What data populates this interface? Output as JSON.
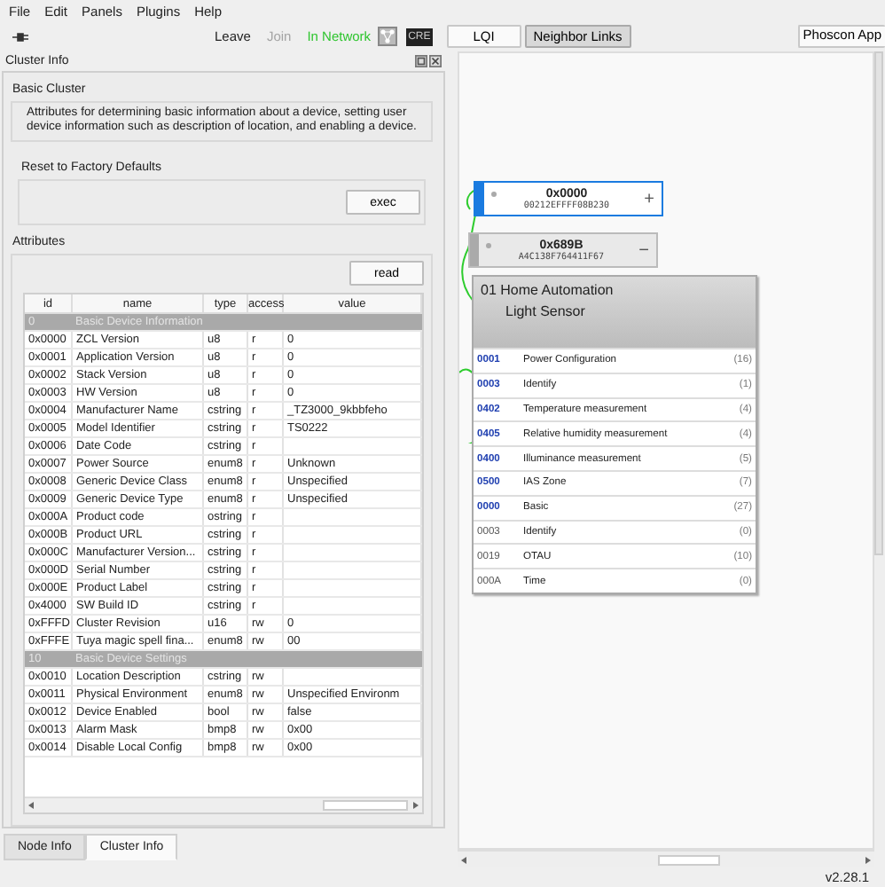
{
  "menu": [
    "File",
    "Edit",
    "Panels",
    "Plugins",
    "Help"
  ],
  "toolbar": {
    "actions": [
      {
        "label": "Leave",
        "disabled": false
      },
      {
        "label": "Join",
        "disabled": true
      }
    ],
    "network_status": "In Network",
    "badge": "CRE",
    "view_buttons": [
      {
        "label": "LQI",
        "pressed": false
      },
      {
        "label": "Neighbor Links",
        "pressed": true
      }
    ],
    "app_button": "Phoscon App"
  },
  "cluster_info": {
    "title": "Cluster Info",
    "cluster_name": "Basic Cluster",
    "description": "Attributes for determining basic information about a device, setting user device information such as description of location, and enabling a device.",
    "command": {
      "label": "Reset to Factory Defaults",
      "button": "exec"
    },
    "attributes_label": "Attributes",
    "read_button": "read",
    "columns": [
      "id",
      "name",
      "type",
      "access",
      "value"
    ],
    "rows": [
      {
        "kind": "group",
        "id": "0",
        "name": "Basic Device Information"
      },
      {
        "kind": "attribute",
        "id": "0x0000",
        "name": "ZCL Version",
        "type": "u8",
        "access": "r",
        "value": "0"
      },
      {
        "kind": "attribute",
        "id": "0x0001",
        "name": "Application Version",
        "type": "u8",
        "access": "r",
        "value": "0"
      },
      {
        "kind": "attribute",
        "id": "0x0002",
        "name": "Stack Version",
        "type": "u8",
        "access": "r",
        "value": "0"
      },
      {
        "kind": "attribute",
        "id": "0x0003",
        "name": "HW Version",
        "type": "u8",
        "access": "r",
        "value": "0"
      },
      {
        "kind": "attribute",
        "id": "0x0004",
        "name": "Manufacturer Name",
        "type": "cstring",
        "access": "r",
        "value": "_TZ3000_9kbbfeho"
      },
      {
        "kind": "attribute",
        "id": "0x0005",
        "name": "Model Identifier",
        "type": "cstring",
        "access": "r",
        "value": "TS0222"
      },
      {
        "kind": "attribute",
        "id": "0x0006",
        "name": "Date Code",
        "type": "cstring",
        "access": "r"
      },
      {
        "kind": "attribute",
        "id": "0x0007",
        "name": "Power Source",
        "type": "enum8",
        "access": "r",
        "value": "Unknown"
      },
      {
        "kind": "attribute",
        "id": "0x0008",
        "name": "Generic Device Class",
        "type": "enum8",
        "access": "r",
        "value": "Unspecified"
      },
      {
        "kind": "attribute",
        "id": "0x0009",
        "name": "Generic Device Type",
        "type": "enum8",
        "access": "r",
        "value": "Unspecified"
      },
      {
        "kind": "attribute",
        "id": "0x000A",
        "name": "Product code",
        "type": "ostring",
        "access": "r"
      },
      {
        "kind": "attribute",
        "id": "0x000B",
        "name": "Product URL",
        "type": "cstring",
        "access": "r"
      },
      {
        "kind": "attribute",
        "id": "0x000C",
        "name": "Manufacturer Version...",
        "type": "cstring",
        "access": "r"
      },
      {
        "kind": "attribute",
        "id": "0x000D",
        "name": "Serial Number",
        "type": "cstring",
        "access": "r"
      },
      {
        "kind": "attribute",
        "id": "0x000E",
        "name": "Product Label",
        "type": "cstring",
        "access": "r"
      },
      {
        "kind": "attribute",
        "id": "0x4000",
        "name": "SW Build ID",
        "type": "cstring",
        "access": "r"
      },
      {
        "kind": "attribute",
        "id": "0xFFFD",
        "name": "Cluster Revision",
        "type": "u16",
        "access": "rw",
        "value": "0"
      },
      {
        "kind": "attribute",
        "id": "0xFFFE",
        "name": "Tuya magic spell fina...",
        "type": "enum8",
        "access": "rw",
        "value": "00"
      },
      {
        "kind": "group",
        "id": "10",
        "name": "Basic Device Settings"
      },
      {
        "kind": "attribute",
        "id": "0x0010",
        "name": "Location Description",
        "type": "cstring",
        "access": "rw"
      },
      {
        "kind": "attribute",
        "id": "0x0011",
        "name": "Physical Environment",
        "type": "enum8",
        "access": "rw",
        "value": "Unspecified Environm"
      },
      {
        "kind": "attribute",
        "id": "0x0012",
        "name": "Device Enabled",
        "type": "bool",
        "access": "rw",
        "value": "false"
      },
      {
        "kind": "attribute",
        "id": "0x0013",
        "name": "Alarm Mask",
        "type": "bmp8",
        "access": "rw",
        "value": "0x00"
      },
      {
        "kind": "attribute",
        "id": "0x0014",
        "name": "Disable Local Config",
        "type": "bmp8",
        "access": "rw",
        "value": "0x00"
      }
    ]
  },
  "tabs": [
    {
      "label": "Node Info",
      "selected": false
    },
    {
      "label": "Cluster Info",
      "selected": true
    }
  ],
  "canvas": {
    "nodes": [
      {
        "address": "0x0000",
        "mac": "00212EFFFF08B230",
        "button": "+",
        "selected": true
      },
      {
        "address": "0x689B",
        "mac": "A4C138F764411F67",
        "button": "−",
        "selected": false
      }
    ],
    "endpoint": {
      "title": "01 Home Automation",
      "subtitle": "Light Sensor",
      "clusters": [
        {
          "id": "0001",
          "name": "Power Configuration",
          "count": "(16)",
          "kind": "server"
        },
        {
          "id": "0003",
          "name": "Identify",
          "count": "(1)",
          "kind": "server"
        },
        {
          "id": "0402",
          "name": "Temperature measurement",
          "count": "(4)",
          "kind": "server"
        },
        {
          "id": "0405",
          "name": "Relative humidity measurement",
          "count": "(4)",
          "kind": "server"
        },
        {
          "id": "0400",
          "name": "Illuminance measurement",
          "count": "(5)",
          "kind": "server"
        },
        {
          "id": "0500",
          "name": "IAS Zone",
          "count": "(7)",
          "kind": "server"
        },
        {
          "id": "0000",
          "name": "Basic",
          "count": "(27)",
          "kind": "server"
        },
        {
          "id": "0003",
          "name": "Identify",
          "count": "(0)",
          "kind": "client"
        },
        {
          "id": "0019",
          "name": "OTAU",
          "count": "(10)",
          "kind": "client"
        },
        {
          "id": "000A",
          "name": "Time",
          "count": "(0)",
          "kind": "client"
        }
      ]
    }
  },
  "status_bar": {
    "version": "v2.28.1"
  }
}
